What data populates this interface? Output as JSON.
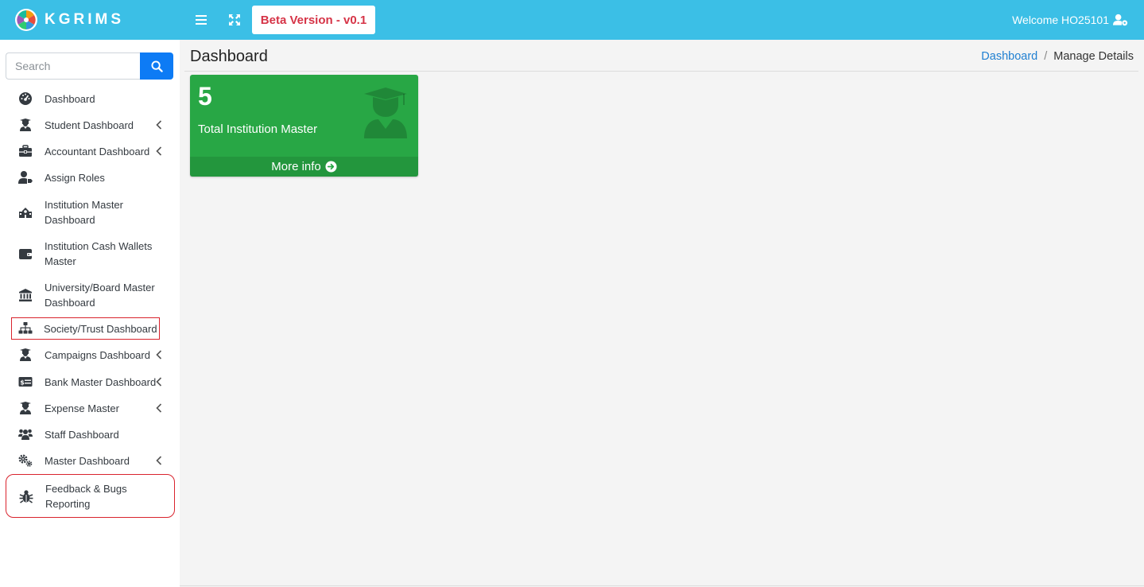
{
  "brand": {
    "name": "KGRIMS"
  },
  "topbar": {
    "beta_label": "Beta Version - v0.1",
    "welcome_text": "Welcome HO25101"
  },
  "search": {
    "placeholder": "Search"
  },
  "sidebar": {
    "items": [
      {
        "label": "Dashboard",
        "icon": "dashboard-gauge-icon"
      },
      {
        "label": "Student Dashboard",
        "icon": "graduate-icon",
        "has_submenu": true
      },
      {
        "label": "Accountant Dashboard",
        "icon": "briefcase-icon",
        "has_submenu": true
      },
      {
        "label": "Assign Roles",
        "icon": "user-tag-icon"
      },
      {
        "label": "Institution Master Dashboard",
        "icon": "school-icon"
      },
      {
        "label": "Institution Cash Wallets Master",
        "icon": "wallet-icon"
      },
      {
        "label": "University/Board Master Dashboard",
        "icon": "university-icon"
      },
      {
        "label": "Society/Trust Dashboard",
        "icon": "sitemap-icon",
        "highlighted": true
      },
      {
        "label": "Campaigns Dashboard",
        "icon": "graduate-icon",
        "has_submenu": true
      },
      {
        "label": "Bank Master Dashboard",
        "icon": "money-check-icon",
        "has_submenu": true
      },
      {
        "label": "Expense Master",
        "icon": "graduate-icon",
        "has_submenu": true
      },
      {
        "label": "Staff Dashboard",
        "icon": "users-icon"
      },
      {
        "label": "Master Dashboard",
        "icon": "cogs-icon",
        "has_submenu": true
      },
      {
        "label": "Feedback & Bugs Reporting",
        "icon": "bug-icon",
        "highlighted": true
      }
    ]
  },
  "main": {
    "page_title": "Dashboard",
    "breadcrumb": {
      "link": "Dashboard",
      "separator": "/",
      "current": "Manage Details"
    },
    "card": {
      "count": "5",
      "label": "Total Institution Master",
      "more_info": "More info",
      "icon": "graduate-icon",
      "color": "#28a745"
    }
  },
  "colors": {
    "topbar": "#3bbfe6",
    "search_button": "#0d7bf5",
    "beta_text": "#d63447",
    "highlight_border": "#d9232d",
    "breadcrumb_link": "#1f7fd1"
  }
}
